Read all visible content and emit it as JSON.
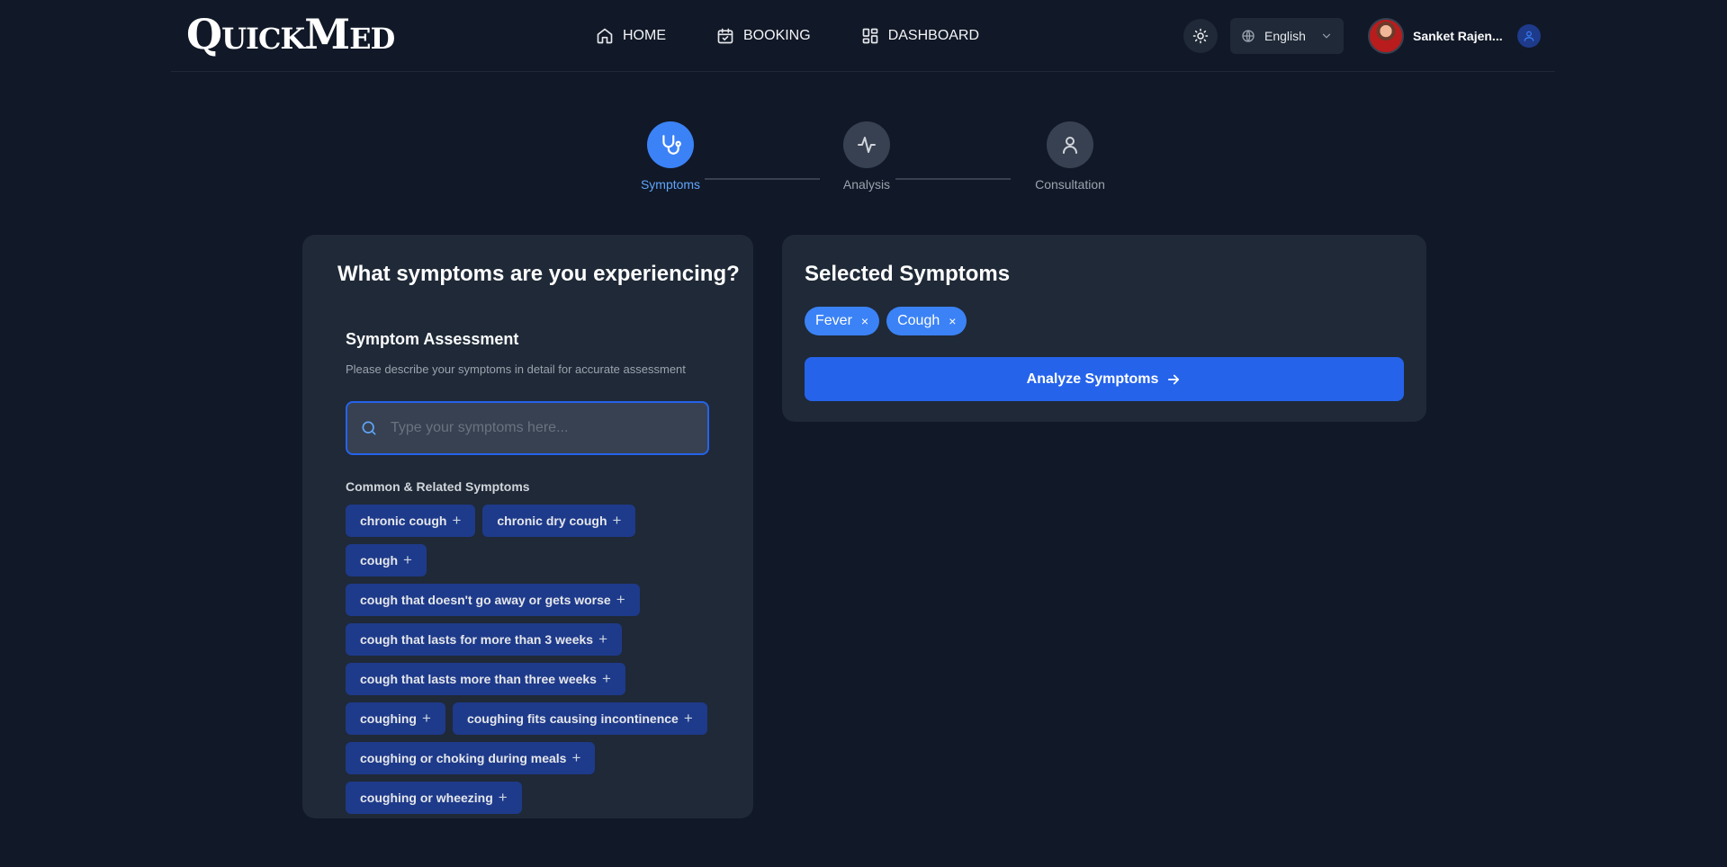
{
  "brand": {
    "logo": "QuickMed"
  },
  "nav": {
    "home": "HOME",
    "booking": "BOOKING",
    "dashboard": "DASHBOARD"
  },
  "header": {
    "language": "English",
    "user_name": "Sanket Rajen..."
  },
  "stepper": {
    "steps": [
      {
        "label": "Symptoms",
        "icon": "stethoscope-icon",
        "active": true
      },
      {
        "label": "Analysis",
        "icon": "activity-icon",
        "active": false
      },
      {
        "label": "Consultation",
        "icon": "user-icon",
        "active": false
      }
    ]
  },
  "left_panel": {
    "title": "What symptoms are you experiencing?",
    "assessment_title": "Symptom Assessment",
    "assessment_subtitle": "Please describe your symptoms in detail for accurate assessment",
    "search_placeholder": "Type your symptoms here...",
    "related_title": "Common & Related Symptoms",
    "chips": [
      "chronic cough",
      "chronic dry cough",
      "cough",
      "cough that doesn't go away or gets worse",
      "cough that lasts for more than 3 weeks",
      "cough that lasts more than three weeks",
      "coughing",
      "coughing fits causing incontinence",
      "coughing or choking during meals",
      "coughing or wheezing"
    ],
    "chip_add_symbol": "+"
  },
  "right_panel": {
    "title": "Selected Symptoms",
    "selected": [
      "Fever",
      "Cough"
    ],
    "remove_symbol": "×",
    "analyze_button": "Analyze Symptoms"
  },
  "colors": {
    "background": "#111827",
    "card": "#1f2937",
    "accent": "#3b82f6",
    "primary_button": "#2563eb",
    "chip": "#1e3a8a"
  }
}
